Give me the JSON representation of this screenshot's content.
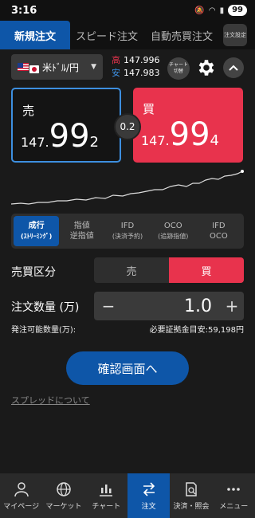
{
  "status": {
    "time": "3:16",
    "battery": "99"
  },
  "tabs": [
    {
      "label": "新規注文",
      "active": true
    },
    {
      "label": "スピード注文",
      "active": false
    },
    {
      "label": "自動売買注文",
      "active": false
    }
  ],
  "tab_settings_label": "注文設定",
  "pair": {
    "name": "米ﾄﾞﾙ/円",
    "high_label": "高",
    "high": "147.996",
    "low_label": "安",
    "low": "147.983"
  },
  "chart_switch_label": "チャート切替",
  "sell": {
    "label": "売",
    "prefix": "147.",
    "big": "99",
    "last": "2"
  },
  "buy": {
    "label": "買",
    "prefix": "147.",
    "big": "99",
    "last": "4"
  },
  "spread": "0.2",
  "order_types": [
    {
      "line1": "成行",
      "line2": "(ｽﾄﾘｰﾐﾝｸﾞ)",
      "active": true
    },
    {
      "line1": "指値",
      "line2": "逆指値",
      "active": false
    },
    {
      "line1": "IFD",
      "line2": "(決済予約)",
      "active": false
    },
    {
      "line1": "OCO",
      "line2": "(追跡指値)",
      "active": false
    },
    {
      "line1": "IFD",
      "line2": "OCO",
      "active": false
    }
  ],
  "trade_type": {
    "label": "売買区分",
    "sell": "売",
    "buy": "買",
    "selected": "buy"
  },
  "quantity": {
    "label": "注文数量 (万)",
    "value": "1.0",
    "minus": "−",
    "plus": "+"
  },
  "available_label": "発注可能数量(万):",
  "margin_label": "必要証拠金目安:59,198円",
  "confirm_label": "確認画面へ",
  "spread_link": "スプレッドについて",
  "nav": [
    {
      "label": "マイページ",
      "icon": "person-icon",
      "active": false
    },
    {
      "label": "マーケット",
      "icon": "globe-icon",
      "active": false
    },
    {
      "label": "チャート",
      "icon": "chart-icon",
      "active": false
    },
    {
      "label": "注文",
      "icon": "exchange-icon",
      "active": true
    },
    {
      "label": "決済・照会",
      "icon": "document-search-icon",
      "active": false
    },
    {
      "label": "メニュー",
      "icon": "more-icon",
      "active": false
    }
  ]
}
